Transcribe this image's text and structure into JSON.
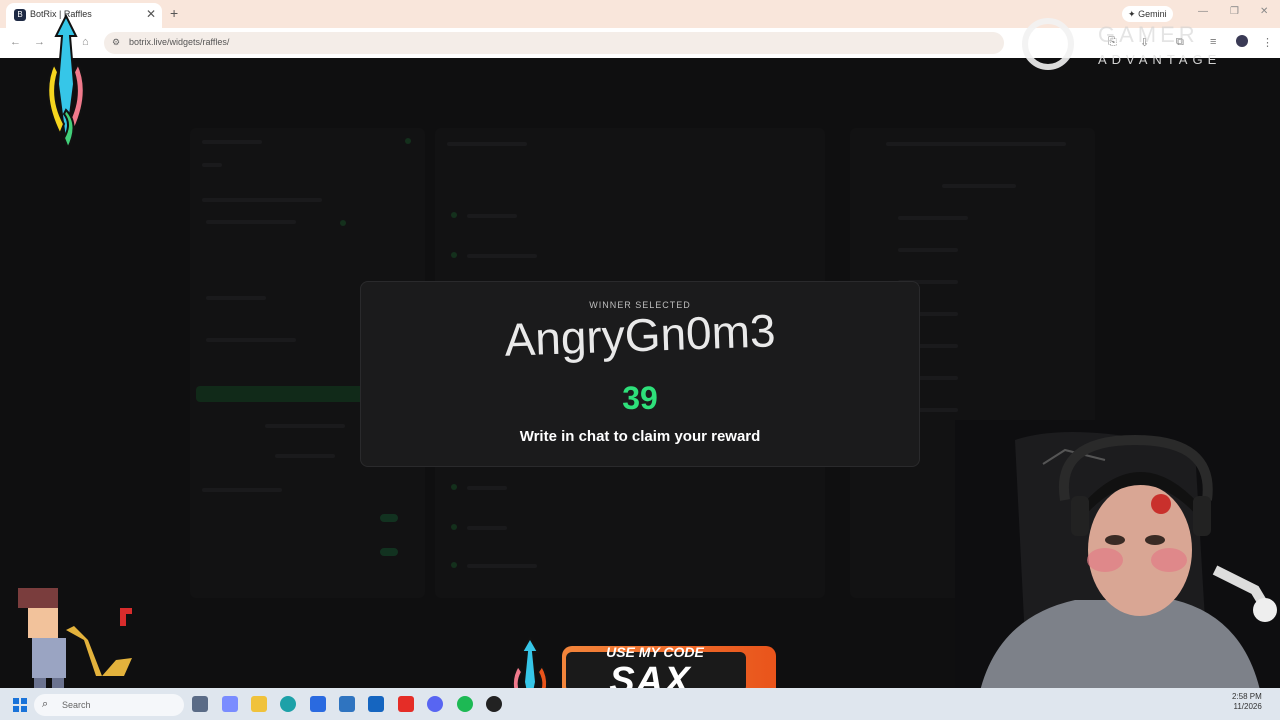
{
  "browser": {
    "tab_title": "BotRix | Raffles",
    "tab_close": "✕",
    "new_tab": "+",
    "gemini_label": "Gemini",
    "url": "botrix.live/widgets/raffles/"
  },
  "modal": {
    "label": "WINNER SELECTED",
    "winner_name": "AngryGn0m3",
    "winner_count": "39",
    "subtitle": "Write in chat to claim your reward"
  },
  "overlay": {
    "brand_name": "GAMER",
    "brand_sub": "ADVANTAGE",
    "code_label": "USE MY CODE",
    "code_value": "SAX"
  },
  "taskbar": {
    "search_placeholder": "Search",
    "clock_time": "2:58 PM",
    "clock_date": "11/2026"
  },
  "colors": {
    "accent_green": "#2ee07a",
    "code_orange": "#f3853b",
    "tabbar_bg": "#f9e6db"
  }
}
